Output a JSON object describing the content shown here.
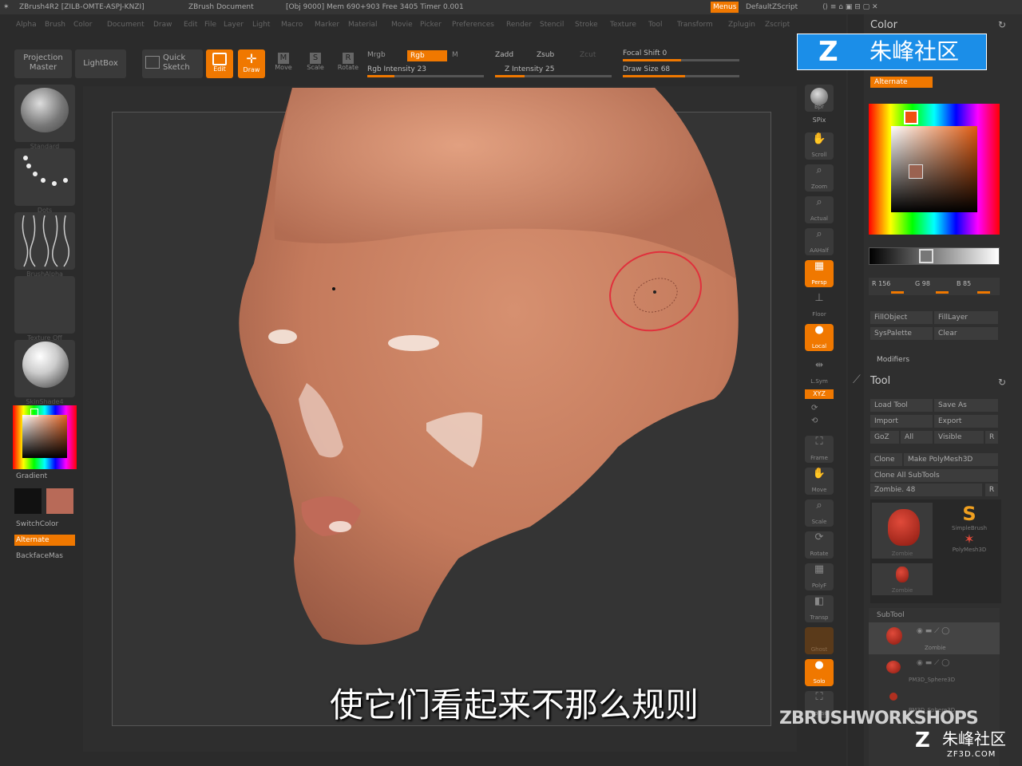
{
  "titlebar": {
    "app": "ZBrush4R2 [ZILB-OMTE-ASPJ-KNZI]",
    "doc": "ZBrush Document",
    "stats": "[Obj 9000] Mem 690+903 Free 3405 Timer 0.001",
    "menus_btn": "Menus",
    "script": "DefaultZScript"
  },
  "menubar": [
    "Alpha",
    "Brush",
    "Color",
    "Document",
    "Draw",
    "Edit",
    "File",
    "Layer",
    "Light",
    "Macro",
    "Marker",
    "Material",
    "Movie",
    "Picker",
    "Preferences",
    "Render",
    "Stencil",
    "Stroke",
    "Texture",
    "Tool",
    "Transform",
    "Zplugin",
    "Zscript"
  ],
  "toolbar": {
    "projection_master": "Projection Master",
    "lightbox": "LightBox",
    "quick_sketch": "Quick Sketch",
    "edit": "Edit",
    "draw": "Draw",
    "move": "Move",
    "scale": "Scale",
    "rotate": "Rotate",
    "mrgb": "Mrgb",
    "rgb": "Rgb",
    "m": "M",
    "rgb_intensity": "Rgb Intensity 23",
    "zadd": "Zadd",
    "zsub": "Zsub",
    "zcut": "Zcut",
    "z_intensity": "Z Intensity 25",
    "focal_shift": "Focal Shift 0",
    "draw_size": "Draw Size 68",
    "rgb_intensity_value": 23,
    "z_intensity_value": 25,
    "draw_size_value": 68
  },
  "left_shelf": {
    "brush": "Standard",
    "stroke": "Dots",
    "alpha": "BrushAlpha",
    "texture": "Texture Off",
    "material": "SkinShade4",
    "gradient": "Gradient",
    "switch_color": "SwitchColor",
    "alternate": "Alternate",
    "backface": "BackfaceMas",
    "secondary_color": "#b86a58"
  },
  "right_shelf": [
    "Bpr",
    "SPix",
    "Scroll",
    "Zoom",
    "Actual",
    "AAHalf",
    "Persp",
    "Floor",
    "Local",
    "L.Sym",
    "XYZ",
    "Frame",
    "Move",
    "Scale",
    "Rotate",
    "PolyF",
    "Transp",
    "Ghost",
    "Solo",
    "Xpose"
  ],
  "subtitle": "使它们看起来不那么规则",
  "palette": {
    "color_title": "Color",
    "alternate": "Alternate",
    "r": "R 156",
    "g": "G 98",
    "b": "B 85",
    "fill_object": "FillObject",
    "fill_layer": "FillLayer",
    "sys_palette": "SysPalette",
    "clear": "Clear",
    "modifiers": "Modifiers",
    "tool_title": "Tool",
    "load_tool": "Load Tool",
    "save_as": "Save As",
    "import": "Import",
    "export": "Export",
    "goz": "GoZ",
    "all": "All",
    "visible": "Visible",
    "r_btn": "R",
    "clone": "Clone",
    "make_polymesh": "Make PolyMesh3D",
    "clone_all": "Clone All SubTools",
    "tool_name": "Zombie. 48",
    "tool1": "Zombie",
    "tool2": "SimpleBrush",
    "tool3": "PolyMesh3D",
    "tool4": "Zombie",
    "subtool": "SubTool",
    "sub1": "Zombie",
    "sub2": "PM3D_Sphere3D",
    "sub3": "PM3D_Sphere3D"
  },
  "watermark": {
    "top": "朱峰社区",
    "bottom": "朱峰社区",
    "url": "ZF3D.COM",
    "zbw": "ZBRUSHWORKSHOPS"
  },
  "colors": {
    "accent": "#f07800",
    "brush_ring": "#e0303c"
  }
}
